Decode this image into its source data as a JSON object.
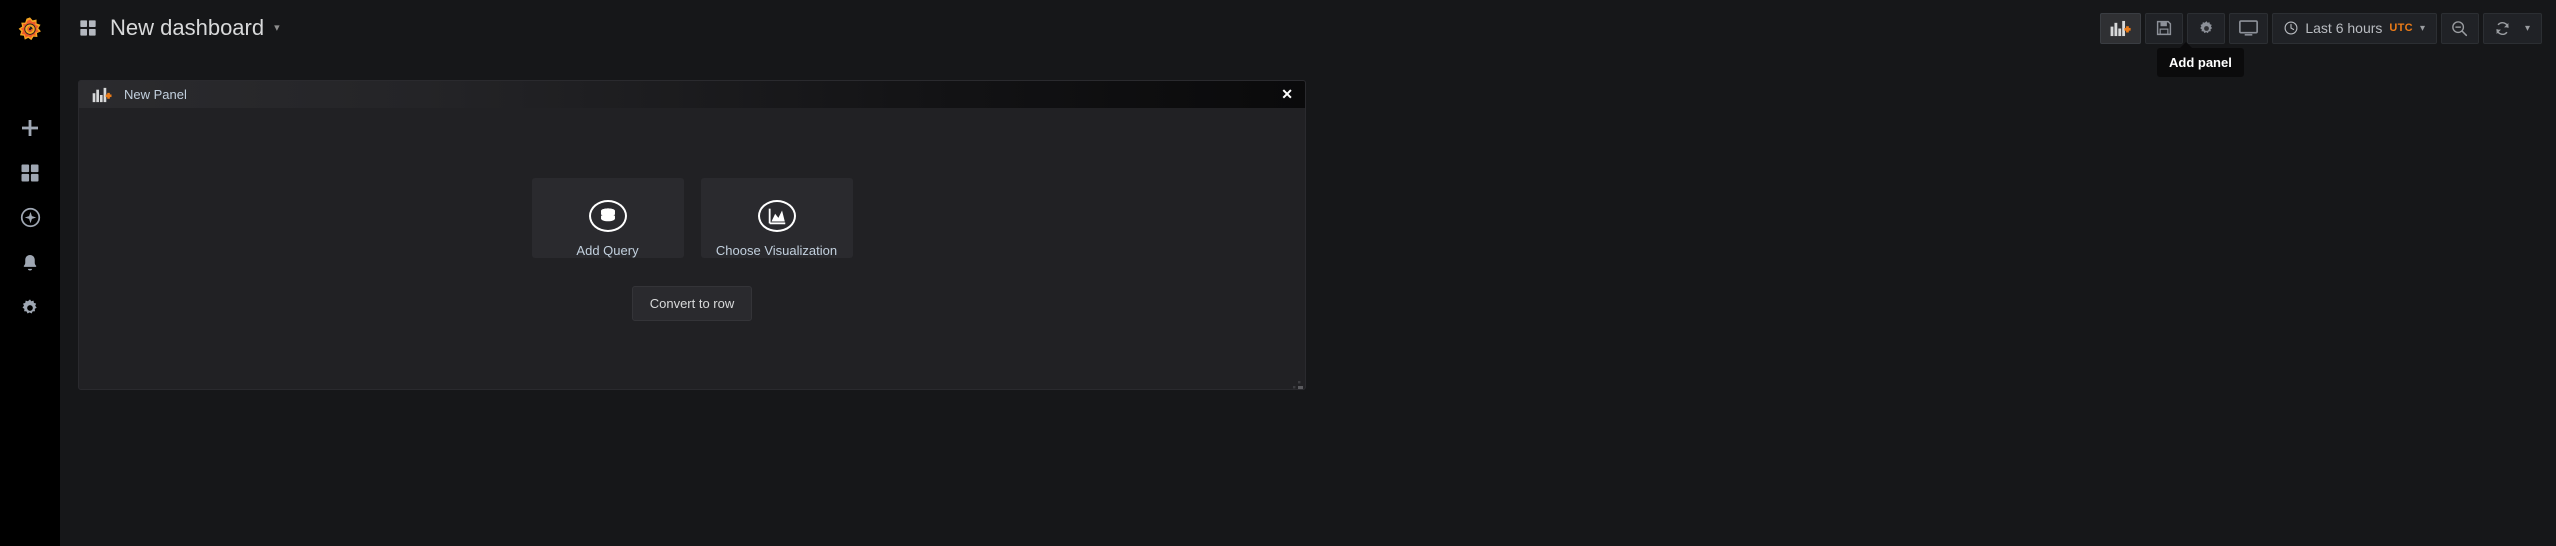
{
  "colors": {
    "brand_orange": "#eb7b18",
    "app_background": "#161719",
    "sidenav_background": "#000000",
    "panel_background": "#212124",
    "card_background": "#2a2a2e",
    "text_primary": "#d8d9da",
    "text_link": "#c2d0de",
    "tooltip_background": "#0b0b0c"
  },
  "sidenav": {
    "logo": {
      "name": "grafana-logo"
    },
    "items": [
      {
        "icon": "plus-icon",
        "label": "Create"
      },
      {
        "icon": "dashboards-icon",
        "label": "Dashboards"
      },
      {
        "icon": "compass-icon",
        "label": "Explore"
      },
      {
        "icon": "bell-icon",
        "label": "Alerting"
      },
      {
        "icon": "gear-icon",
        "label": "Configuration"
      }
    ]
  },
  "topbar": {
    "grid_icon": "dashboard-grid-icon",
    "title": "New dashboard",
    "title_caret": "▾",
    "actions": [
      {
        "icon": "add-panel-icon",
        "label": "Add panel",
        "active": true
      },
      {
        "icon": "save-icon",
        "label": "Save dashboard",
        "active": false
      },
      {
        "icon": "gear-icon",
        "label": "Dashboard settings",
        "active": false
      },
      {
        "icon": "tv-icon",
        "label": "Cycle view mode",
        "active": false
      }
    ],
    "time_picker": {
      "clock_icon": "clock-icon",
      "range_label": "Last 6 hours",
      "timezone": "UTC",
      "caret": "▾"
    },
    "zoom_out": {
      "icon": "zoom-out-icon",
      "label": "Zoom out time range"
    },
    "refresh": {
      "icon": "refresh-icon",
      "label": "Refresh dashboard",
      "caret": "▾"
    }
  },
  "tooltip": {
    "visible": true,
    "text": "Add panel"
  },
  "panel": {
    "header": {
      "icon": "add-panel-icon",
      "title": "New Panel",
      "close_label": "✕"
    },
    "cta_cards": [
      {
        "icon": "database-icon",
        "label": "Add Query"
      },
      {
        "icon": "area-chart-icon",
        "label": "Choose Visualization"
      }
    ],
    "convert_button": "Convert to row",
    "resize_handle": "panel-resize-handle"
  }
}
